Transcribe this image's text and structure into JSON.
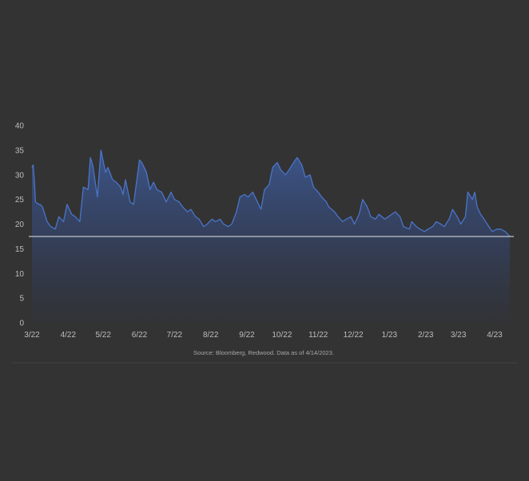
{
  "chart_data": {
    "type": "area",
    "title": "",
    "xlabel": "",
    "ylabel": "",
    "ylim": [
      0,
      40
    ],
    "y_ticks": [
      0,
      5,
      10,
      15,
      20,
      25,
      30,
      35,
      40
    ],
    "y_tick_labels": [
      "0",
      "5",
      "10",
      "15",
      "20",
      "25",
      "30",
      "35",
      "40"
    ],
    "x_range": [
      "2022-03-01",
      "2023-04-14"
    ],
    "x_ticks": [
      {
        "date": "2022-03-01",
        "label": "3/22"
      },
      {
        "date": "2022-04-01",
        "label": "4/22"
      },
      {
        "date": "2022-05-01",
        "label": "5/22"
      },
      {
        "date": "2022-06-01",
        "label": "6/22"
      },
      {
        "date": "2022-07-01",
        "label": "7/22"
      },
      {
        "date": "2022-08-01",
        "label": "8/22"
      },
      {
        "date": "2022-09-01",
        "label": "9/22"
      },
      {
        "date": "2022-10-01",
        "label": "10/22"
      },
      {
        "date": "2022-11-01",
        "label": "11/22"
      },
      {
        "date": "2022-12-01",
        "label": "12/22"
      },
      {
        "date": "2023-01-01",
        "label": "1/23"
      },
      {
        "date": "2023-02-01",
        "label": "2/23"
      },
      {
        "date": "2023-03-01",
        "label": "3/23"
      },
      {
        "date": "2023-04-01",
        "label": "4/23"
      }
    ],
    "reference_line": {
      "value": 17.5
    },
    "grid": false,
    "legend": "none",
    "colors": {
      "line": "#4a74c9",
      "fill_top": "#3e5c9c",
      "fill_bottom": "#2f3340",
      "reference_line": "#e6e6e6",
      "axis_text": "#bdbdbd",
      "source_text": "#a6a6a6",
      "background": "#333333"
    },
    "series": [
      {
        "x": [
          "2022-03-01",
          "2022-03-02",
          "2022-03-03",
          "2022-03-04",
          "2022-03-07",
          "2022-03-08",
          "2022-03-10",
          "2022-03-14",
          "2022-03-17",
          "2022-03-21",
          "2022-03-24",
          "2022-03-28",
          "2022-03-31",
          "2022-04-04",
          "2022-04-07",
          "2022-04-11",
          "2022-04-14",
          "2022-04-18",
          "2022-04-20",
          "2022-04-22",
          "2022-04-26",
          "2022-04-29",
          "2022-05-03",
          "2022-05-05",
          "2022-05-09",
          "2022-05-12",
          "2022-05-16",
          "2022-05-18",
          "2022-05-20",
          "2022-05-24",
          "2022-05-27",
          "2022-06-01",
          "2022-06-03",
          "2022-06-07",
          "2022-06-10",
          "2022-06-13",
          "2022-06-16",
          "2022-06-20",
          "2022-06-24",
          "2022-06-28",
          "2022-07-01",
          "2022-07-05",
          "2022-07-08",
          "2022-07-12",
          "2022-07-15",
          "2022-07-19",
          "2022-07-22",
          "2022-07-26",
          "2022-07-29",
          "2022-08-02",
          "2022-08-05",
          "2022-08-09",
          "2022-08-12",
          "2022-08-16",
          "2022-08-19",
          "2022-08-23",
          "2022-08-26",
          "2022-08-30",
          "2022-09-02",
          "2022-09-06",
          "2022-09-09",
          "2022-09-13",
          "2022-09-16",
          "2022-09-20",
          "2022-09-23",
          "2022-09-27",
          "2022-09-30",
          "2022-10-04",
          "2022-10-07",
          "2022-10-11",
          "2022-10-14",
          "2022-10-18",
          "2022-10-21",
          "2022-10-25",
          "2022-10-28",
          "2022-11-01",
          "2022-11-04",
          "2022-11-08",
          "2022-11-10",
          "2022-11-15",
          "2022-11-18",
          "2022-11-22",
          "2022-11-25",
          "2022-11-29",
          "2022-12-02",
          "2022-12-06",
          "2022-12-09",
          "2022-12-13",
          "2022-12-16",
          "2022-12-20",
          "2022-12-23",
          "2022-12-28",
          "2023-01-03",
          "2023-01-06",
          "2023-01-10",
          "2023-01-13",
          "2023-01-18",
          "2023-01-20",
          "2023-01-24",
          "2023-01-27",
          "2023-01-31",
          "2023-02-03",
          "2023-02-07",
          "2023-02-10",
          "2023-02-14",
          "2023-02-17",
          "2023-02-21",
          "2023-02-24",
          "2023-02-28",
          "2023-03-03",
          "2023-03-07",
          "2023-03-09",
          "2023-03-13",
          "2023-03-15",
          "2023-03-17",
          "2023-03-20",
          "2023-03-23",
          "2023-03-27",
          "2023-03-30",
          "2023-04-03",
          "2023-04-06",
          "2023-04-10",
          "2023-04-14"
        ],
        "values": [
          31.5,
          32.0,
          29.0,
          24.5,
          24.0,
          24.0,
          23.5,
          20.5,
          19.5,
          19.0,
          21.5,
          20.5,
          24.0,
          22.0,
          21.5,
          20.5,
          27.5,
          27.0,
          33.5,
          32.0,
          25.5,
          35.0,
          30.5,
          31.5,
          29.0,
          28.5,
          27.5,
          26.0,
          29.0,
          24.5,
          24.0,
          33.0,
          32.5,
          30.5,
          27.0,
          28.5,
          27.0,
          26.5,
          24.5,
          26.5,
          25.0,
          24.5,
          23.5,
          22.5,
          23.0,
          21.5,
          21.0,
          19.5,
          20.0,
          21.0,
          20.5,
          21.0,
          20.0,
          19.5,
          20.0,
          22.5,
          25.5,
          26.0,
          25.5,
          26.5,
          25.0,
          23.0,
          27.0,
          28.0,
          31.5,
          32.5,
          31.0,
          30.0,
          31.0,
          32.5,
          33.5,
          32.0,
          29.5,
          30.0,
          27.5,
          26.5,
          25.5,
          24.5,
          23.5,
          22.5,
          21.5,
          20.5,
          21.0,
          21.5,
          20.0,
          22.0,
          25.0,
          23.5,
          21.5,
          21.0,
          22.0,
          21.0,
          22.0,
          22.5,
          21.5,
          19.5,
          19.0,
          20.5,
          19.5,
          19.0,
          18.5,
          19.0,
          19.5,
          20.5,
          20.0,
          19.5,
          21.0,
          23.0,
          21.5,
          20.0,
          21.5,
          26.5,
          25.0,
          26.5,
          23.5,
          22.0,
          21.0,
          19.5,
          18.5,
          19.0,
          19.0,
          18.5,
          17.5
        ]
      }
    ],
    "source_note": "Source: Bloomberg, Redwood. Data as of 4/14/2023."
  }
}
